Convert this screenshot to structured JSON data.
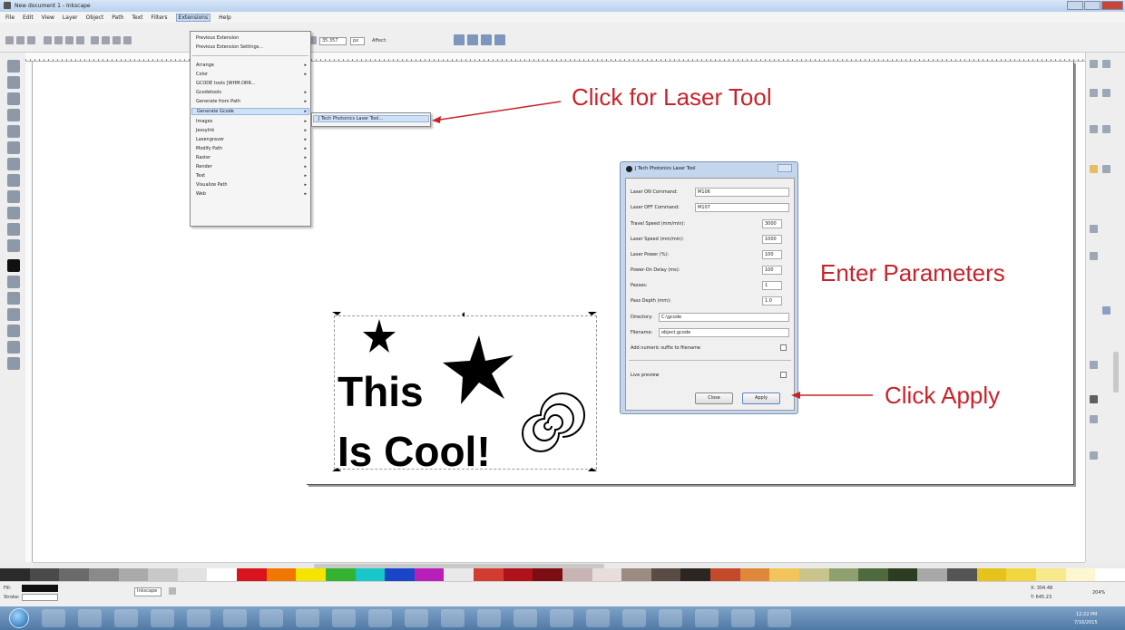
{
  "window": {
    "title": "New document 1 - Inkscape"
  },
  "menubar": {
    "items": [
      "File",
      "Edit",
      "View",
      "Layer",
      "Object",
      "Path",
      "Text",
      "Filters",
      "Extensions",
      "Help"
    ]
  },
  "extensions_menu": {
    "items": [
      {
        "label": "Previous Extension",
        "submenu": false
      },
      {
        "label": "Previous Extension Settings...",
        "submenu": false
      },
      {
        "label": "Arrange",
        "submenu": true
      },
      {
        "label": "Color",
        "submenu": true
      },
      {
        "label": "GCODE tools [WHM.ORR...",
        "submenu": false
      },
      {
        "label": "Gcodetools",
        "submenu": true
      },
      {
        "label": "Generate from Path",
        "submenu": true
      },
      {
        "label": "Generate Gcode",
        "submenu": true
      },
      {
        "label": "Images",
        "submenu": true
      },
      {
        "label": "JessyInk",
        "submenu": true
      },
      {
        "label": "Lasengraver",
        "submenu": true
      },
      {
        "label": "Modify Path",
        "submenu": true
      },
      {
        "label": "Raster",
        "submenu": true
      },
      {
        "label": "Render",
        "submenu": true
      },
      {
        "label": "Text",
        "submenu": true
      },
      {
        "label": "Visualize Path",
        "submenu": true
      },
      {
        "label": "Web",
        "submenu": true
      }
    ],
    "submenu_item": "J Tech Photonics Laser Tool..."
  },
  "toolbar": {
    "zoom_value": "35.357",
    "unit": "px",
    "affect_label": "Affect:"
  },
  "dialog": {
    "title": "J Tech Photonics Laser Tool",
    "fields": [
      {
        "label": "Laser ON Command:",
        "value": "M106"
      },
      {
        "label": "Laser OFF Command:",
        "value": "M107"
      },
      {
        "label": "Travel Speed (mm/min):",
        "value": "3000"
      },
      {
        "label": "Laser Speed (mm/min):",
        "value": "1000"
      },
      {
        "label": "Laser Power (%):",
        "value": "100"
      },
      {
        "label": "Power-On Delay (ms):",
        "value": "100"
      },
      {
        "label": "Passes:",
        "value": "1"
      },
      {
        "label": "Pass Depth (mm):",
        "value": "1.0"
      },
      {
        "label": "Directory:",
        "value": "C:\\gcode"
      },
      {
        "label": "Filename:",
        "value": "object.gcode"
      }
    ],
    "numeric_suffix_label": "Add numeric suffix to filename",
    "live_preview_label": "Live preview",
    "close_label": "Close",
    "apply_label": "Apply"
  },
  "canvas": {
    "line1": "This",
    "line2": "Is Cool!"
  },
  "annotations": {
    "laser_tool": "Click for Laser Tool",
    "parameters": "Enter Parameters",
    "apply": "Click Apply"
  },
  "palette": {
    "colors": [
      "#2b2b2b",
      "#4a4a4a",
      "#6a6a6a",
      "#8a8a8a",
      "#aaaaaa",
      "#c8c8c8",
      "#e2e2e2",
      "#ffffff",
      "#d9141c",
      "#f07800",
      "#f5e400",
      "#34b232",
      "#17c7c9",
      "#1b45c9",
      "#b81fb8",
      "#e9e9e9",
      "#d23b2f",
      "#b0121b",
      "#7c0d12",
      "#c9b4b4",
      "#e8dcdc",
      "#9c8b80",
      "#5a4b44",
      "#2c2522",
      "#c24a2a",
      "#e0873a",
      "#f3c45a",
      "#c9c48c",
      "#8ea06d",
      "#4f6b3d",
      "#2c3d22",
      "#a8a8a8",
      "#555555",
      "#e6c21c",
      "#f1d640",
      "#f7e98c",
      "#fdf7d0",
      "#ffffff"
    ]
  },
  "statusbar": {
    "fill_label": "Fill:",
    "stroke_label": "Stroke:",
    "layer": "Inkscape",
    "zoom": "204%",
    "coords_x": "X: 304.48",
    "coords_y": "Y: 645.23"
  },
  "taskbar": {
    "clock_time": "12:22 PM",
    "clock_date": "7/16/2015"
  }
}
